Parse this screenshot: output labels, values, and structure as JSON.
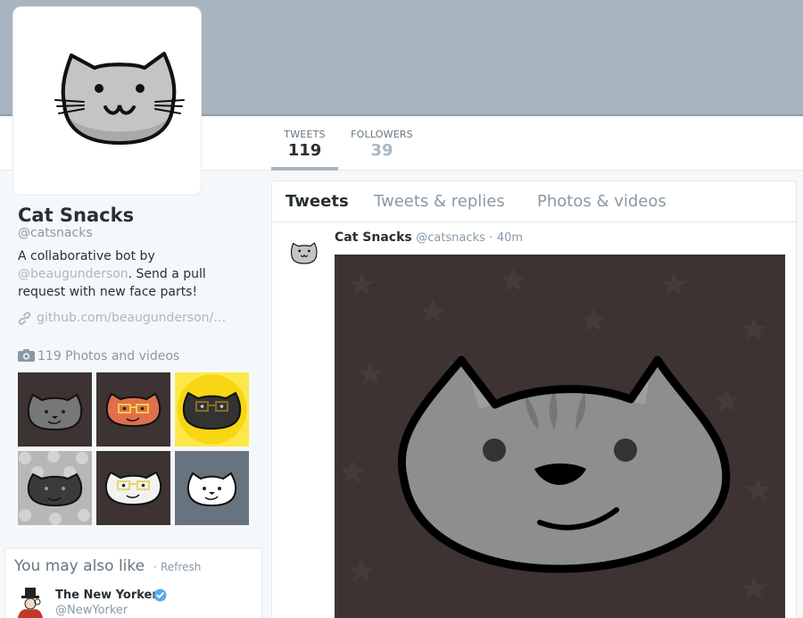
{
  "profile": {
    "name": "Cat Snacks",
    "handle": "@catsnacks",
    "bio_prefix": "A collaborative bot by",
    "bio_mention": "@beaugunderson",
    "bio_suffix": ". Send a pull request with new face parts!",
    "link": "github.com/beaugunderson/…"
  },
  "stats": {
    "tweets_label": "TWEETS",
    "tweets_value": "119",
    "followers_label": "FOLLOWERS",
    "followers_value": "39"
  },
  "photos": {
    "label": "119 Photos and videos",
    "thumbnails": [
      {
        "name": "thumb-gray-tabby-cat",
        "bg": "#3d3333"
      },
      {
        "name": "thumb-orange-cat-glasses",
        "bg": "#3d3333"
      },
      {
        "name": "thumb-black-cat-glasses",
        "bg": "#fde84a"
      },
      {
        "name": "thumb-dark-cat-polka-dots",
        "bg": "#b7b7b7"
      },
      {
        "name": "thumb-white-cat-glasses",
        "bg": "#3d3333"
      },
      {
        "name": "thumb-white-cat-slate",
        "bg": "#67737f"
      }
    ]
  },
  "who_to_follow": {
    "title": "You may also like",
    "separator": "·",
    "refresh": "Refresh",
    "account": {
      "name": "The New Yorker",
      "handle": "@NewYorker",
      "verified": true
    }
  },
  "timeline": {
    "tabs": [
      "Tweets",
      "Tweets & replies",
      "Photos & videos"
    ],
    "active_tab": "Tweets",
    "tweet": {
      "name": "Cat Snacks",
      "handle": "@catsnacks",
      "separator": "·",
      "time": "40m"
    }
  },
  "colors": {
    "banner": "#a8b5c0",
    "accent": "#aab8c2",
    "verified": "#55acee",
    "image_bg": "#3d3333"
  },
  "icons": {
    "link": "link-icon",
    "camera": "camera-icon",
    "verified": "verified-badge-icon"
  }
}
